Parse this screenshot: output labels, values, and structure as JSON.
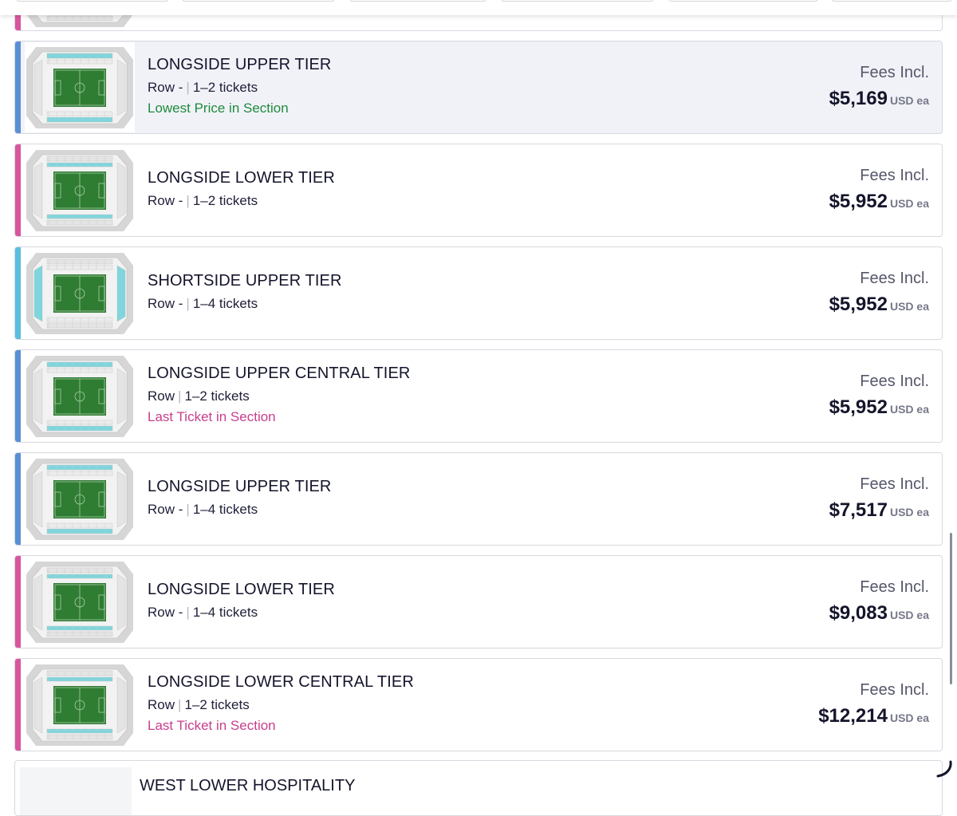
{
  "colors": {
    "blue_accent": "#5a8fd6",
    "pink_accent": "#d9559f",
    "cyan_accent": "#5bbedc",
    "lowest_price": "#1f8a3c",
    "last_ticket": "#c83e8d",
    "pitch": "#2f7d32"
  },
  "listings": [
    {
      "title": "LONGSIDE UPPER TIER",
      "row_label": "Row -",
      "tickets": "1–2 tickets",
      "note": "Lowest Price in Section",
      "note_type": "green",
      "fees_label": "Fees Incl.",
      "price": "$5,169",
      "unit": "USD ea",
      "accent": "blue",
      "highlight_section": "longside-upper",
      "selected": true
    },
    {
      "title": "LONGSIDE LOWER TIER",
      "row_label": "Row -",
      "tickets": "1–2 tickets",
      "note": "",
      "note_type": "",
      "fees_label": "Fees Incl.",
      "price": "$5,952",
      "unit": "USD ea",
      "accent": "pink",
      "highlight_section": "longside-lower",
      "selected": false
    },
    {
      "title": "SHORTSIDE UPPER TIER",
      "row_label": "Row -",
      "tickets": "1–4 tickets",
      "note": "",
      "note_type": "",
      "fees_label": "Fees Incl.",
      "price": "$5,952",
      "unit": "USD ea",
      "accent": "cyan",
      "highlight_section": "shortside-upper",
      "selected": false
    },
    {
      "title": "LONGSIDE UPPER CENTRAL TIER",
      "row_label": "Row",
      "tickets": "1–2 tickets",
      "note": "Last Ticket in Section",
      "note_type": "pink",
      "fees_label": "Fees Incl.",
      "price": "$5,952",
      "unit": "USD ea",
      "accent": "blue",
      "highlight_section": "longside-upper",
      "selected": false
    },
    {
      "title": "LONGSIDE UPPER TIER",
      "row_label": "Row -",
      "tickets": "1–4 tickets",
      "note": "",
      "note_type": "",
      "fees_label": "Fees Incl.",
      "price": "$7,517",
      "unit": "USD ea",
      "accent": "blue",
      "highlight_section": "longside-upper",
      "selected": false
    },
    {
      "title": "LONGSIDE LOWER TIER",
      "row_label": "Row -",
      "tickets": "1–4 tickets",
      "note": "",
      "note_type": "",
      "fees_label": "Fees Incl.",
      "price": "$9,083",
      "unit": "USD ea",
      "accent": "pink",
      "highlight_section": "longside-lower",
      "selected": false
    },
    {
      "title": "LONGSIDE LOWER CENTRAL TIER",
      "row_label": "Row",
      "tickets": "1–2 tickets",
      "note": "Last Ticket in Section",
      "note_type": "pink",
      "fees_label": "Fees Incl.",
      "price": "$12,214",
      "unit": "USD ea",
      "accent": "pink",
      "highlight_section": "longside-lower",
      "selected": false
    }
  ],
  "partial_top": {
    "accent": "pink"
  },
  "partial_bottom": {
    "title": "WEST LOWER HOSPITALITY"
  },
  "icons": {
    "loading": "spinner-icon",
    "map": "stadium-map-icon"
  }
}
